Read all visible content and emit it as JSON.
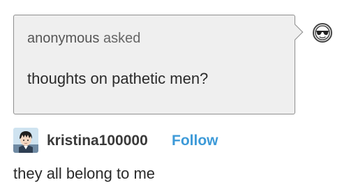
{
  "ask": {
    "asker_name": "anonymous",
    "asked_label": "asked",
    "question": "thoughts on pathetic men?",
    "asker_avatar_icon": "anonymous-sunglasses-icon"
  },
  "answer": {
    "username": "kristina100000",
    "follow_label": "Follow",
    "body": "they all belong to me",
    "avatar_icon": "anime-character-avatar"
  },
  "colors": {
    "bubble_bg": "#efefef",
    "bubble_border": "#8f8f8f",
    "follow_link": "#3d9ad8",
    "text": "#2a2a2a"
  }
}
